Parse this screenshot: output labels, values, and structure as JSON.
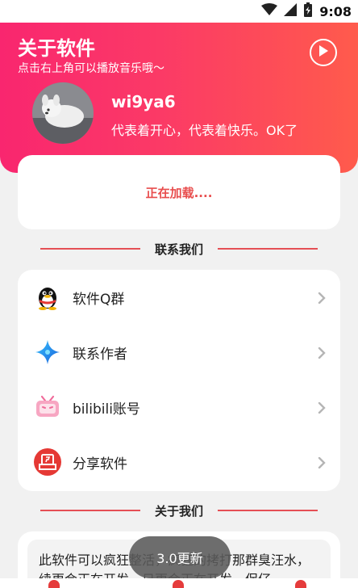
{
  "status_bar": {
    "time": "9:08",
    "icons": [
      "wifi-icon",
      "signal-icon",
      "battery-charging-icon"
    ]
  },
  "header": {
    "title": "关于软件",
    "subtitle": "点击右上角可以播放音乐哦～",
    "play_icon": "play-circle-icon",
    "username": "wi9ya6",
    "motto": "代表着开心，代表着快乐。OK了"
  },
  "loading_card": {
    "text": "正在加载...."
  },
  "contact_section": {
    "title": "联系我们",
    "items": [
      {
        "label": "软件Q群",
        "icon": "qq-penguin-icon"
      },
      {
        "label": "联系作者",
        "icon": "star-sparkle-icon"
      },
      {
        "label": "bilibili账号",
        "icon": "bilibili-tv-icon"
      },
      {
        "label": "分享软件",
        "icon": "share-icon"
      }
    ]
  },
  "about_section": {
    "title": "关于我们",
    "text": "此软件可以疯狂整活，疯狂的拷打那群臭汪水，续更会正在开发，日更会正在开发，保仔"
  },
  "toast": {
    "text": "3.0更新"
  },
  "colors": {
    "accent": "#f9266f",
    "accent_end": "#ff5b4c",
    "loading_text": "#e84d4d",
    "divider": "#e54f55"
  }
}
